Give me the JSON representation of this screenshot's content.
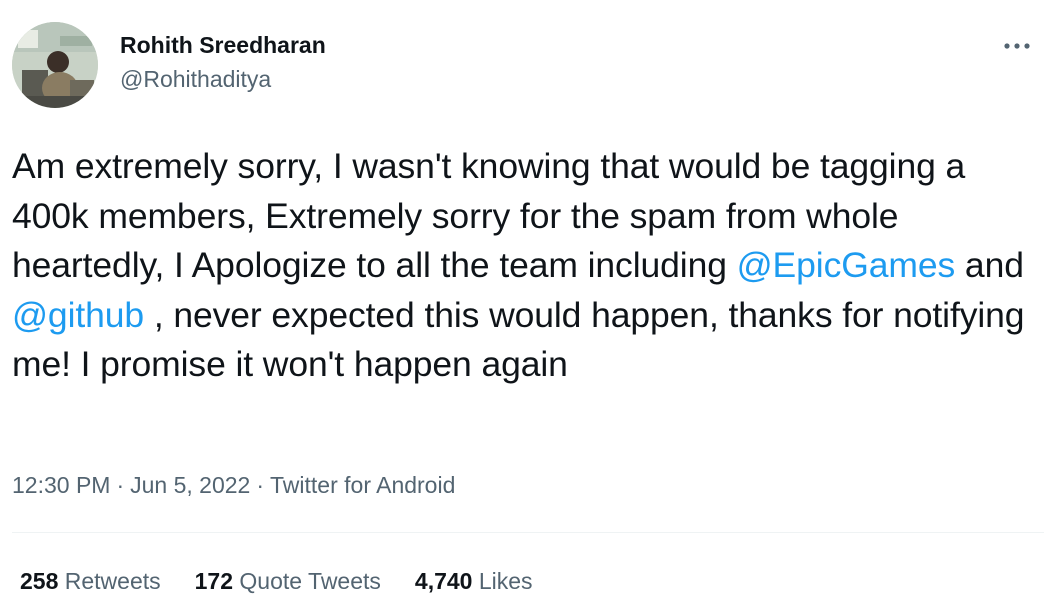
{
  "author": {
    "display_name": "Rohith Sreedharan",
    "handle": "@Rohithaditya"
  },
  "icons": {
    "more": "more-dots-icon",
    "avatar": "profile-photo"
  },
  "tweet": {
    "text_parts": [
      "Am extremely sorry, I wasn't knowing that would be tagging a 400k members, Extremely sorry for the spam from whole heartedly, I Apologize to all the team including ",
      "@EpicGames",
      " and ",
      "@github",
      " , never expected this would happen, thanks for notifying me! I promise it won't happen again"
    ]
  },
  "meta": {
    "time": "12:30 PM",
    "separator": "·",
    "date": "Jun 5, 2022",
    "source": "Twitter for Android"
  },
  "stats": {
    "retweets_count": "258",
    "retweets_label": "Retweets",
    "quotes_count": "172",
    "quotes_label": "Quote Tweets",
    "likes_count": "4,740",
    "likes_label": "Likes"
  },
  "colors": {
    "text": "#0f1419",
    "secondary": "#536471",
    "link": "#1d9bf0",
    "divider": "#eff3f4"
  }
}
